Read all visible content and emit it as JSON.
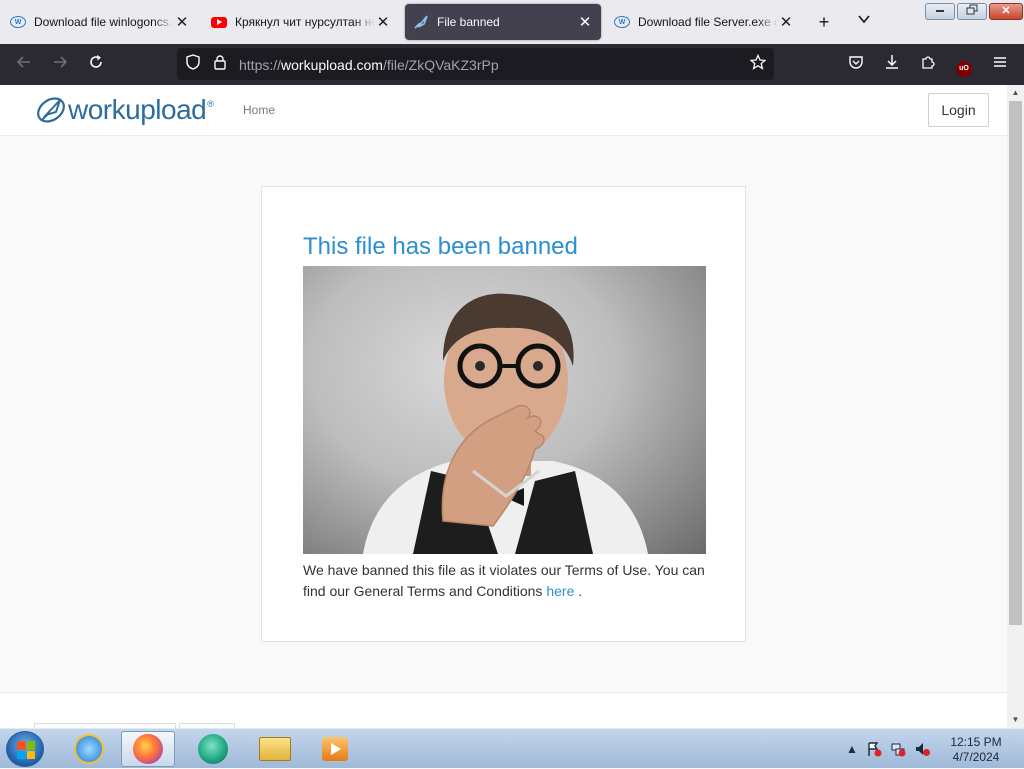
{
  "browser": {
    "tabs": [
      {
        "title": "Download file winlogoncs.e",
        "favicon": "workupload-icon",
        "active": false
      },
      {
        "title": "Кряк​нул чит нурсултан не",
        "favicon": "youtube-icon",
        "active": false
      },
      {
        "title": "File banned",
        "favicon": "workupload-icon",
        "active": true
      },
      {
        "title": "Download file Server.exe on",
        "favicon": "workupload-icon",
        "active": false
      }
    ],
    "new_tab_icon": "+",
    "tab_list_icon": "⌄",
    "close_glyph": "✕",
    "url_prefix": "https://",
    "url_host": "workupload.com",
    "url_path": "/file/ZkQVaKZ3rPp",
    "window_buttons": {
      "minimize": "▭",
      "restore": "❐",
      "close": "✕"
    }
  },
  "site": {
    "logo": {
      "word_a": "work",
      "word_b": "upload",
      "mark": "®"
    },
    "nav_home": "Home",
    "login": "Login",
    "card": {
      "title": "This file has been banned",
      "body": "We have banned this file as it violates our Terms of Use. You can find our General Terms and Conditions ",
      "link": "here",
      "trailing": " ."
    }
  },
  "taskbar": {
    "clock_time": "12:15 PM",
    "clock_date": "4/7/2024"
  },
  "colors": {
    "accent_link": "#2b8fd1",
    "logo_blue": "#2c6d9e",
    "browser_dark": "#2b2a33"
  }
}
